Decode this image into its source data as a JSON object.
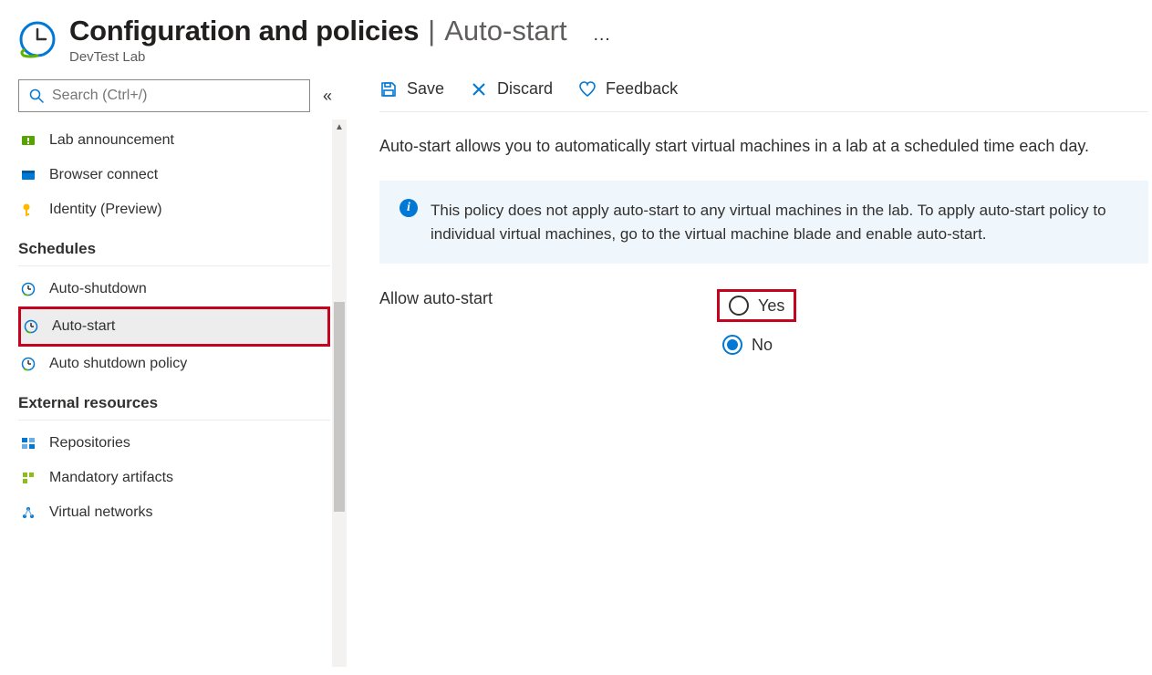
{
  "header": {
    "title_main": "Configuration and policies",
    "title_sub": "Auto-start",
    "subtitle": "DevTest Lab",
    "more_label": "…"
  },
  "search": {
    "placeholder": "Search (Ctrl+/)"
  },
  "sidebar": {
    "items_top": [
      {
        "id": "lab-announcement",
        "label": "Lab announcement",
        "icon": "announcement"
      },
      {
        "id": "browser-connect",
        "label": "Browser connect",
        "icon": "browser"
      },
      {
        "id": "identity-preview",
        "label": "Identity (Preview)",
        "icon": "key"
      }
    ],
    "group_schedules_title": "Schedules",
    "items_schedules": [
      {
        "id": "auto-shutdown",
        "label": "Auto-shutdown",
        "icon": "clock"
      },
      {
        "id": "auto-start",
        "label": "Auto-start",
        "icon": "clock",
        "selected": true,
        "highlight": true
      },
      {
        "id": "auto-shutdown-policy",
        "label": "Auto shutdown policy",
        "icon": "clock"
      }
    ],
    "group_external_title": "External resources",
    "items_external": [
      {
        "id": "repositories",
        "label": "Repositories",
        "icon": "repo"
      },
      {
        "id": "mandatory-artifacts",
        "label": "Mandatory artifacts",
        "icon": "artifacts"
      },
      {
        "id": "virtual-networks",
        "label": "Virtual networks",
        "icon": "vnet"
      }
    ]
  },
  "toolbar": {
    "save_label": "Save",
    "discard_label": "Discard",
    "feedback_label": "Feedback"
  },
  "main": {
    "description": "Auto-start allows you to automatically start virtual machines in a lab at a scheduled time each day.",
    "info_text": "This policy does not apply auto-start to any virtual machines in the lab. To apply auto-start policy to individual virtual machines, go to the virtual machine blade and enable auto-start.",
    "setting_label": "Allow auto-start",
    "options": {
      "yes": "Yes",
      "no": "No",
      "selected": "no"
    }
  },
  "colors": {
    "accent": "#0078d4",
    "highlight_red": "#c4031f"
  }
}
